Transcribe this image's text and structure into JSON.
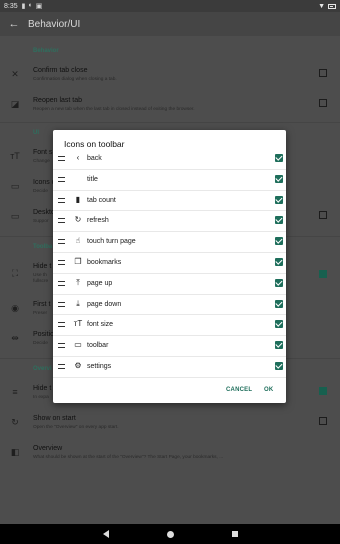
{
  "status_bar": {
    "time": "8:35"
  },
  "app_bar": {
    "title": "Behavior/UI"
  },
  "background": {
    "category_behavior": "Behavior",
    "confirm_tab_close": {
      "title": "Confirm tab close",
      "summary": "Confirmation dialog when closing a tab."
    },
    "reopen_last_tab": {
      "title": "Reopen last tab",
      "summary": "Reopen a new tab when the last tab in closed instead of exiting the browser."
    },
    "category_ui": "UI",
    "font_size": {
      "title": "Font s",
      "summary": "Change"
    },
    "icons_on_toolbar": {
      "title": "Icons o",
      "summary": "Decide"
    },
    "desktop": {
      "title": "Deskto",
      "summary": "Suppor"
    },
    "category_toolbar": "Toolba",
    "hide_toolbar": {
      "title": "Hide t",
      "summary": "Use th",
      "summary2": "fullscre"
    },
    "first_toolbar": {
      "title": "First t",
      "summary": "Preser"
    },
    "position": {
      "title": "Positio",
      "summary": "Decide"
    },
    "category_overview": "Overvi",
    "hide_overview": {
      "title": "Hide t",
      "summary": "In expa"
    },
    "show_on_start": {
      "title": "Show on start",
      "summary": "Open the \"Overview\" on every app start."
    },
    "overview": {
      "title": "Overview",
      "summary": "What should be shown at the start of the \"Overview\"? The Start Page, your bookmarks, ..."
    }
  },
  "dialog": {
    "title": "Icons on toolbar",
    "items": [
      {
        "label": "back",
        "icon": "back-icon",
        "glyph": "‹",
        "checked": true
      },
      {
        "label": "title",
        "icon": "",
        "glyph": "",
        "checked": true
      },
      {
        "label": "tab count",
        "icon": "tab-count-icon",
        "glyph": "▮",
        "checked": true
      },
      {
        "label": "refresh",
        "icon": "refresh-icon",
        "glyph": "↻",
        "checked": true
      },
      {
        "label": "touch turn page",
        "icon": "touch-icon",
        "glyph": "☝",
        "checked": true
      },
      {
        "label": "bookmarks",
        "icon": "bookmarks-icon",
        "glyph": "❐",
        "checked": true
      },
      {
        "label": "page up",
        "icon": "page-up-icon",
        "glyph": "⤒",
        "checked": true
      },
      {
        "label": "page down",
        "icon": "page-down-icon",
        "glyph": "⤓",
        "checked": true
      },
      {
        "label": "font size",
        "icon": "font-size-icon",
        "glyph": "тT",
        "checked": true
      },
      {
        "label": "toolbar",
        "icon": "keyboard-icon",
        "glyph": "▭",
        "checked": true
      },
      {
        "label": "settings",
        "icon": "settings-icon",
        "glyph": "⚙",
        "checked": true
      }
    ],
    "cancel_label": "CANCEL",
    "ok_label": "OK"
  },
  "colors": {
    "accent": "#1e6e5b",
    "scrim_background": "#4d4d4d"
  }
}
